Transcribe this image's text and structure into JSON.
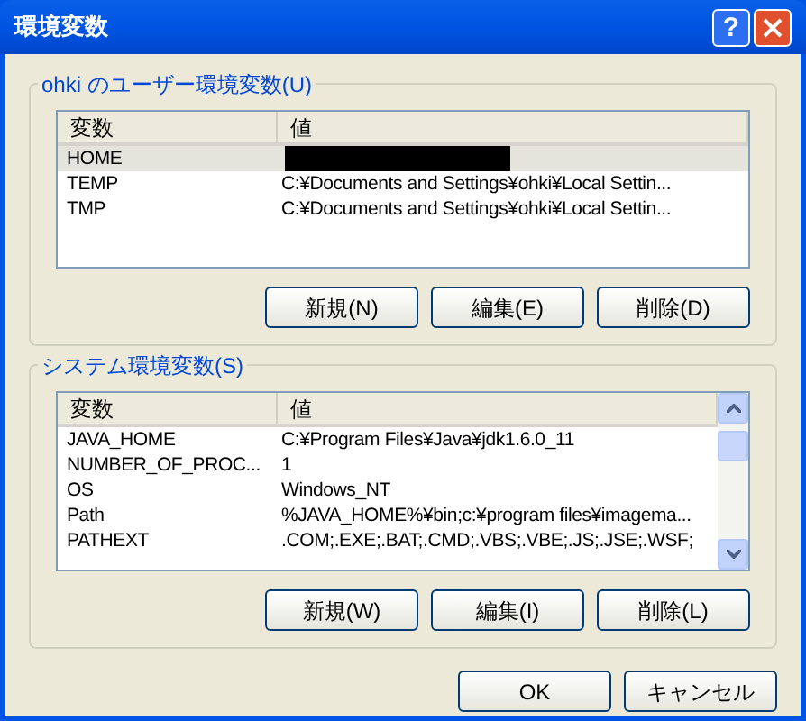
{
  "window": {
    "title": "環境変数"
  },
  "title_buttons": [
    {
      "kind": "help",
      "label": "?"
    },
    {
      "kind": "close"
    }
  ],
  "groups": [
    {
      "label": "ohki のユーザー環境変数(U)",
      "scrollbar": false,
      "columns": [
        "変数",
        "値"
      ],
      "rows": [
        {
          "name": "HOME",
          "value": "",
          "redacted": true,
          "selected": true
        },
        {
          "name": "TEMP",
          "value": "C:¥Documents and Settings¥ohki¥Local Settin...",
          "redacted": false,
          "selected": false
        },
        {
          "name": "TMP",
          "value": "C:¥Documents and Settings¥ohki¥Local Settin...",
          "redacted": false,
          "selected": false
        }
      ],
      "buttons": [
        "新規(N)",
        "編集(E)",
        "削除(D)"
      ]
    },
    {
      "label": "システム環境変数(S)",
      "scrollbar": true,
      "columns": [
        "変数",
        "値"
      ],
      "rows": [
        {
          "name": "JAVA_HOME",
          "value": "C:¥Program Files¥Java¥jdk1.6.0_11",
          "redacted": false,
          "selected": false
        },
        {
          "name": "NUMBER_OF_PROC...",
          "value": "1",
          "redacted": false,
          "selected": false
        },
        {
          "name": "OS",
          "value": "Windows_NT",
          "redacted": false,
          "selected": false
        },
        {
          "name": "Path",
          "value": "%JAVA_HOME%¥bin;c:¥program files¥imagema...",
          "redacted": false,
          "selected": false
        },
        {
          "name": "PATHEXT",
          "value": ".COM;.EXE;.BAT;.CMD;.VBS;.VBE;.JS;.JSE;.WSF;",
          "redacted": false,
          "selected": false
        }
      ],
      "buttons": [
        "新規(W)",
        "編集(I)",
        "削除(L)"
      ]
    }
  ],
  "footer_buttons": [
    "OK",
    "キャンセル"
  ]
}
